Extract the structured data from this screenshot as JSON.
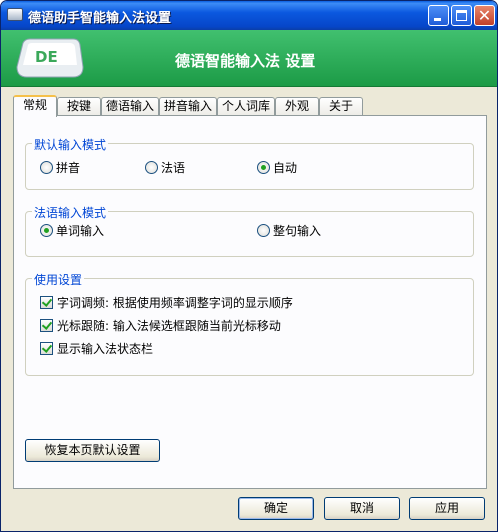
{
  "window": {
    "title": "德语助手智能输入法设置"
  },
  "banner": {
    "title": "德语智能输入法 设置",
    "logo_text": "DE"
  },
  "tabs": [
    {
      "label": "常规"
    },
    {
      "label": "按键"
    },
    {
      "label": "德语输入"
    },
    {
      "label": "拼音输入"
    },
    {
      "label": "个人词库"
    },
    {
      "label": "外观"
    },
    {
      "label": "关于"
    }
  ],
  "active_tab": "常规",
  "default_mode": {
    "title": "默认输入模式",
    "options": [
      {
        "label": "拼音",
        "selected": false
      },
      {
        "label": "法语",
        "selected": false
      },
      {
        "label": "自动",
        "selected": true
      }
    ]
  },
  "french_mode": {
    "title": "法语输入模式",
    "options": [
      {
        "label": "单词输入",
        "selected": true
      },
      {
        "label": "整句输入",
        "selected": false
      }
    ]
  },
  "usage": {
    "title": "使用设置",
    "options": [
      {
        "label": "字词调频: 根据使用频率调整字词的显示顺序",
        "checked": true
      },
      {
        "label": "光标跟随: 输入法候选框跟随当前光标移动",
        "checked": true
      },
      {
        "label": "显示输入法状态栏",
        "checked": true
      }
    ]
  },
  "restore_button": "恢复本页默认设置",
  "footer": {
    "ok": "确定",
    "cancel": "取消",
    "apply": "应用"
  },
  "colors": {
    "titlebar": "#0b58df",
    "banner": "#1c9b46",
    "group_title": "#0046d5",
    "accent_check": "#21a121"
  }
}
